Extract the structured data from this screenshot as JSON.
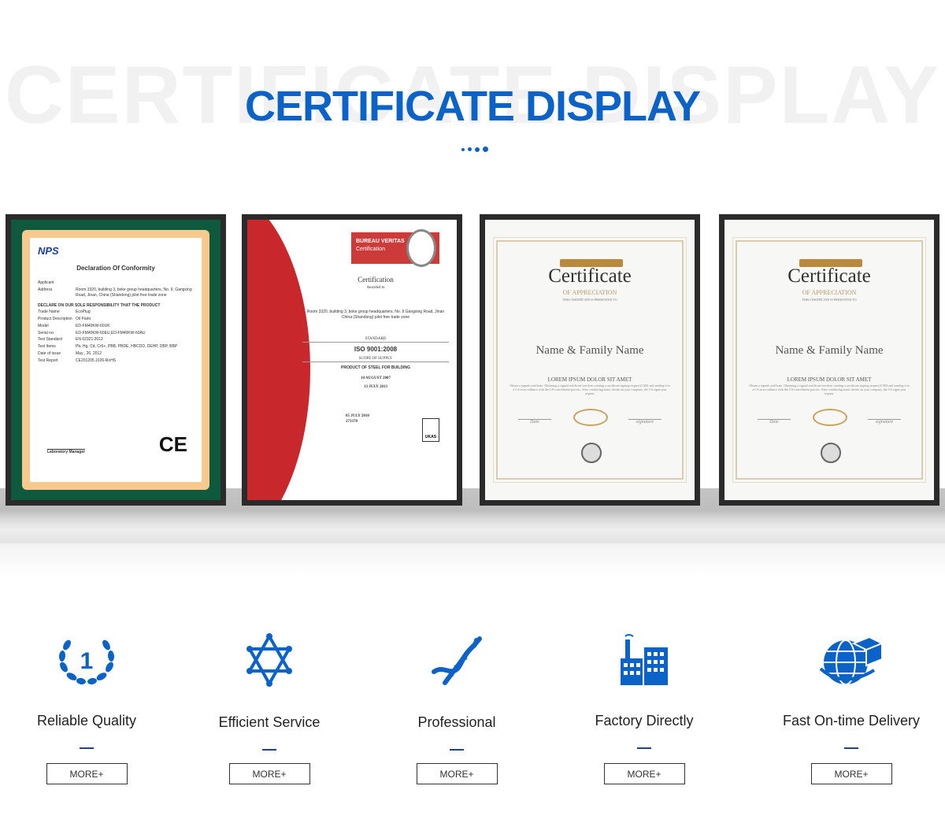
{
  "header": {
    "background_title": "CERTIFICATE DISPLAY",
    "title": "CERTIFICATE DISPLAY",
    "accent_color": "#0b62c9"
  },
  "certificates": [
    {
      "logo": "NPS",
      "title": "Declaration Of Conformity",
      "rows": [
        [
          "Applicant",
          ""
        ],
        [
          "Address",
          "Room 3320, building 3, boke group headquarters, No. 9, Gangxing Road, Jinan, China (Shandong) pilot free trade zone"
        ],
        [
          "DECLARE ON OUR SOLE RESPONSIBILITY THAT THE PRODUCT",
          ""
        ],
        [
          "Trade Name",
          "EcoPlug"
        ],
        [
          "Product Description",
          "Oil Paint"
        ],
        [
          "Model",
          "ED-FM40KW-60UK"
        ],
        [
          "Serial no.",
          "ED-FM40KW-60EU,ED-FM40KW-60AU"
        ],
        [
          "Test Standard",
          "EN 62321:2012"
        ],
        [
          "Test Items",
          "Pb, Hg, Cd, Cr6+, PBB, PBDE, HBCDD, DEHP, DBP, BBP"
        ],
        [
          "Date of issue",
          "May , 26, 2012"
        ],
        [
          "Test Report",
          "CE201205.1026-RoHS"
        ]
      ],
      "signer": "Laboratory Manager",
      "mark": "CE"
    },
    {
      "brand": "BUREAU VERITAS",
      "brand_sub": "Certification",
      "title": "Certification",
      "awarded": "Awarded to",
      "address": "Room 3320, building 3, boke group headquarters, No. 9 Gangxing Road, Jinan China (Shandong) pilot free trade zone",
      "standard_label": "STANDARD",
      "standard": "ISO 9001:2008",
      "scope_label": "SCOPE OF SUPPLY",
      "scope": "PRODUCT OF STEEL FOR BUILDING",
      "date1": "14 AUGUST 2007",
      "date2": "13 JULY 2013",
      "date3": "05 JULY 2010",
      "cert_no": "273378",
      "mark": "UKAS"
    },
    {
      "title": "Certificate",
      "subtitle": "OF APPRECIATION",
      "presented": "THIS CERTIFICATE IS PRESENTED TO",
      "name": "Name & Family Name",
      "heading": "LOREM IPSUM DOLOR SIT AMET",
      "body": "Obtain a signed certificate. Obtaining a signed certificate involves creating a certificate signing request (CSR) and sending it to a CA in accordance with the CA's enrollment process. After conducting some checks on your company, the CA signs your request.",
      "date": "Date",
      "signature": "signature"
    },
    {
      "title": "Certificate",
      "subtitle": "OF APPRECIATION",
      "presented": "THIS CERTIFICATE IS PRESENTED TO",
      "name": "Name & Family Name",
      "heading": "LOREM IPSUM DOLOR SIT AMET",
      "body": "Obtain a signed certificate. Obtaining a signed certificate involves creating a certificate signing request (CSR) and sending it to a CA in accordance with the CA's enrollment process. After conducting some checks on your company, the CA signs your request.",
      "date": "Date",
      "signature": "signature"
    }
  ],
  "features": [
    {
      "icon": "laurel-number-one-icon",
      "label": "Reliable Quality",
      "button": "MORE+"
    },
    {
      "icon": "star-of-david-icon",
      "label": "Efficient Service",
      "button": "MORE+"
    },
    {
      "icon": "dna-icon",
      "label": "Professional",
      "button": "MORE+"
    },
    {
      "icon": "factory-icon",
      "label": "Factory Directly",
      "button": "MORE+"
    },
    {
      "icon": "globe-delivery-icon",
      "label": "Fast On-time Delivery",
      "button": "MORE+"
    }
  ]
}
